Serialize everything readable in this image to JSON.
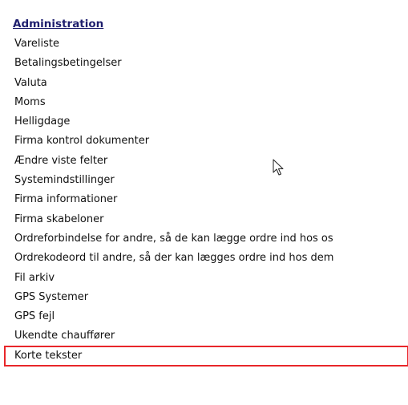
{
  "menu": {
    "title": "Administration",
    "items": [
      {
        "label": "Vareliste"
      },
      {
        "label": "Betalingsbetingelser"
      },
      {
        "label": "Valuta"
      },
      {
        "label": "Moms"
      },
      {
        "label": "Helligdage"
      },
      {
        "label": "Firma kontrol dokumenter"
      },
      {
        "label": "Ændre viste felter"
      },
      {
        "label": "Systemindstillinger"
      },
      {
        "label": "Firma informationer"
      },
      {
        "label": "Firma skabeloner"
      },
      {
        "label": "Ordreforbindelse for andre, så de kan lægge ordre ind hos os"
      },
      {
        "label": "Ordrekodeord til andre, så der kan lægges ordre ind hos dem"
      },
      {
        "label": "Fil arkiv"
      },
      {
        "label": "GPS Systemer"
      },
      {
        "label": "GPS fejl"
      },
      {
        "label": "Ukendte chauffører"
      },
      {
        "label": "Korte tekster"
      }
    ]
  },
  "colors": {
    "title": "#1f1f6e",
    "text": "#111111",
    "highlight_border": "#e8262a"
  },
  "icons": {
    "cursor": "mouse-pointer-icon"
  }
}
